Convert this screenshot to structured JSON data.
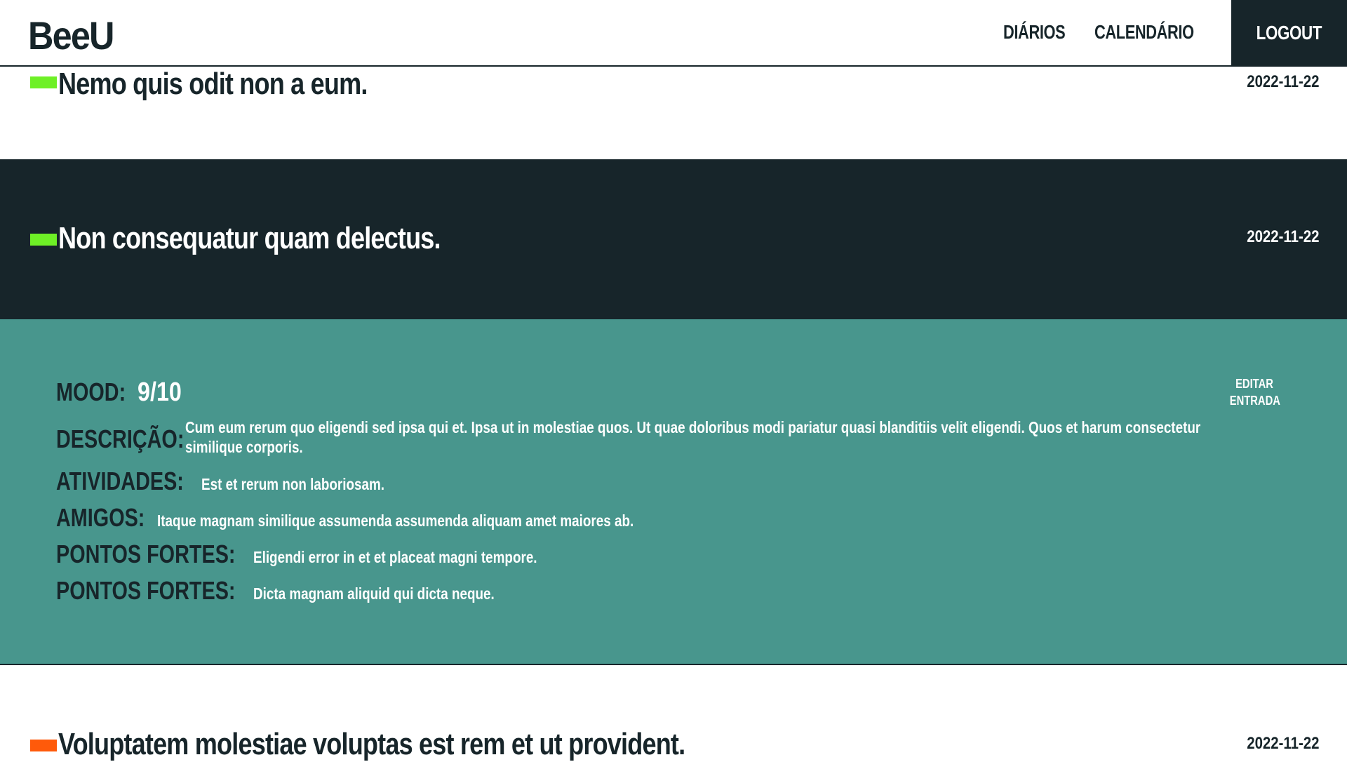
{
  "header": {
    "logo": "BeeU",
    "nav": {
      "diarios": "DIÁRIOS",
      "calendario": "CALENDÁRIO"
    },
    "logout": "LOGOUT"
  },
  "colors": {
    "dark": "#17252a",
    "teal": "#48968d",
    "mood_green": "#6ef026",
    "mood_orange": "#ff5a0a"
  },
  "entries": [
    {
      "title": "Nemo quis odit non a eum.",
      "date": "2022-11-22",
      "mood_color": "green"
    },
    {
      "title": "Non consequatur quam delectus.",
      "date": "2022-11-22",
      "mood_color": "green",
      "expanded": true
    },
    {
      "title": "Voluptatem molestiae voluptas est rem et ut provident.",
      "date": "2022-11-22",
      "mood_color": "orange"
    }
  ],
  "detail": {
    "mood_label": "MOOD:",
    "mood_value": "9/10",
    "descricao_label": "DESCRIÇÃO:",
    "descricao_value": "Cum eum rerum quo eligendi sed ipsa qui et. Ipsa ut in molestiae quos. Ut quae doloribus modi pariatur quasi blanditiis velit eligendi. Quos et harum consectetur similique corporis.",
    "atividades_label": "ATIVIDADES:",
    "atividades_value": "Est et rerum non laboriosam.",
    "amigos_label": "AMIGOS:",
    "amigos_value": "Itaque magnam similique assumenda assumenda aliquam amet maiores ab.",
    "pontos_fortes_label_1": "PONTOS FORTES:",
    "pontos_fortes_value_1": "Eligendi error in et et placeat magni tempore.",
    "pontos_fortes_label_2": "PONTOS FORTES:",
    "pontos_fortes_value_2": "Dicta magnam aliquid qui dicta neque.",
    "edit_line1": "EDITAR",
    "edit_line2": "ENTRADA"
  }
}
